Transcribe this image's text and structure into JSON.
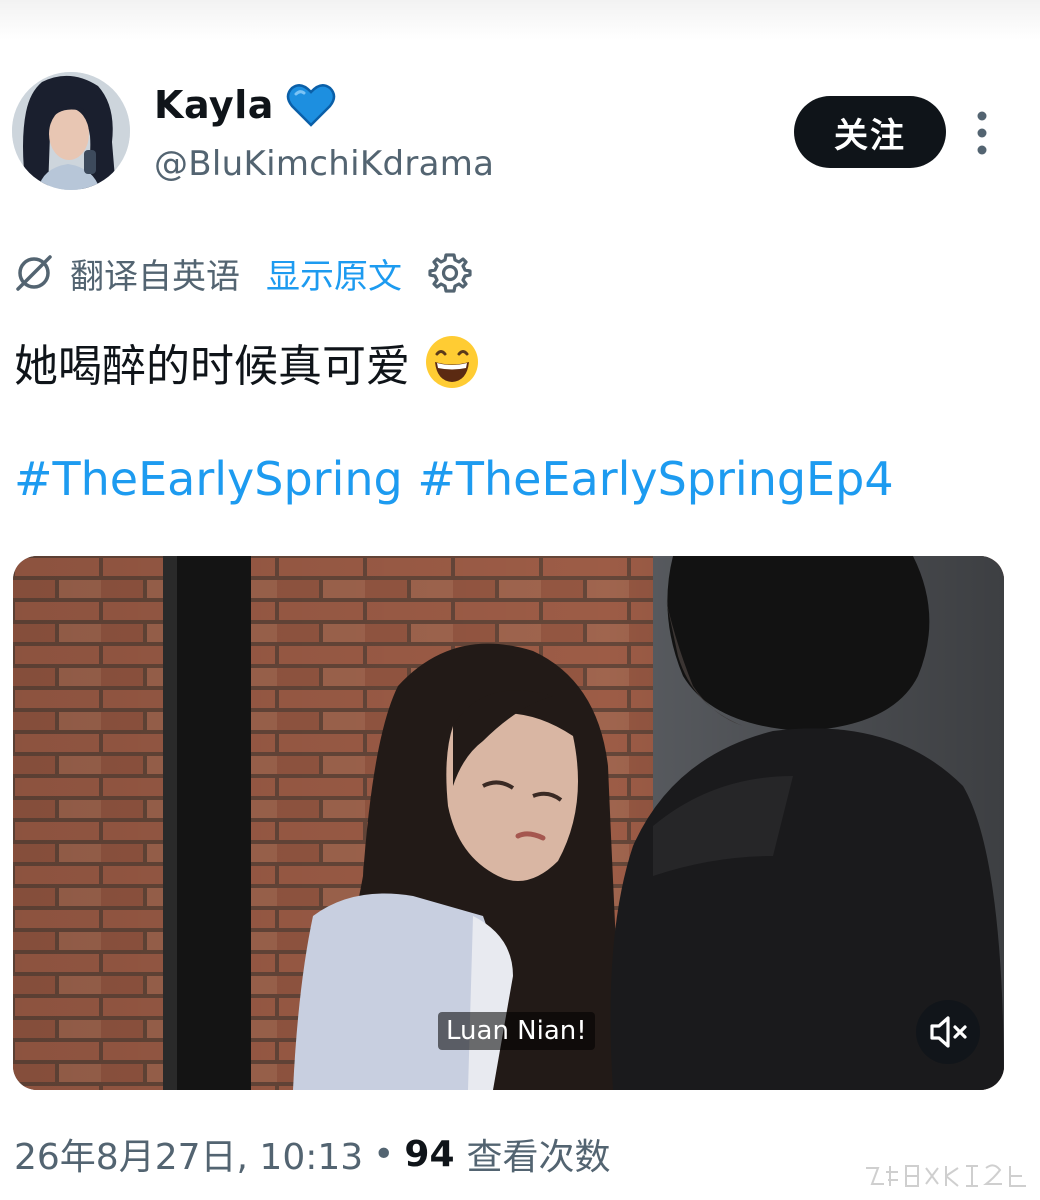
{
  "author": {
    "display_name": "Kayla",
    "handle": "@BluKimchiKdrama",
    "verified_emoji_icon": "blue-heart-icon"
  },
  "actions": {
    "follow_label": "关注",
    "more_icon": "more-vertical-icon"
  },
  "translation": {
    "icon": "translate-icon",
    "label": "翻译自英语",
    "show_original_label": "显示原文",
    "settings_icon": "gear-icon"
  },
  "tweet": {
    "text": "她喝醉的时候真可爱",
    "emoji_icon": "grinning-face-emoji-icon",
    "hashtags": [
      "#TheEarlySpring",
      "#TheEarlySpringEp4"
    ]
  },
  "video": {
    "subtitle": "Luan Nian!",
    "mute_icon": "speaker-muted-icon"
  },
  "meta": {
    "timestamp": "26年8月27日, 10:13",
    "separator": "•",
    "views_count": "94",
    "views_label": "查看次数"
  },
  "colors": {
    "text_primary": "#0f1419",
    "text_secondary": "#536471",
    "link_blue": "#1d9bf0",
    "button_dark": "#0f1419"
  }
}
